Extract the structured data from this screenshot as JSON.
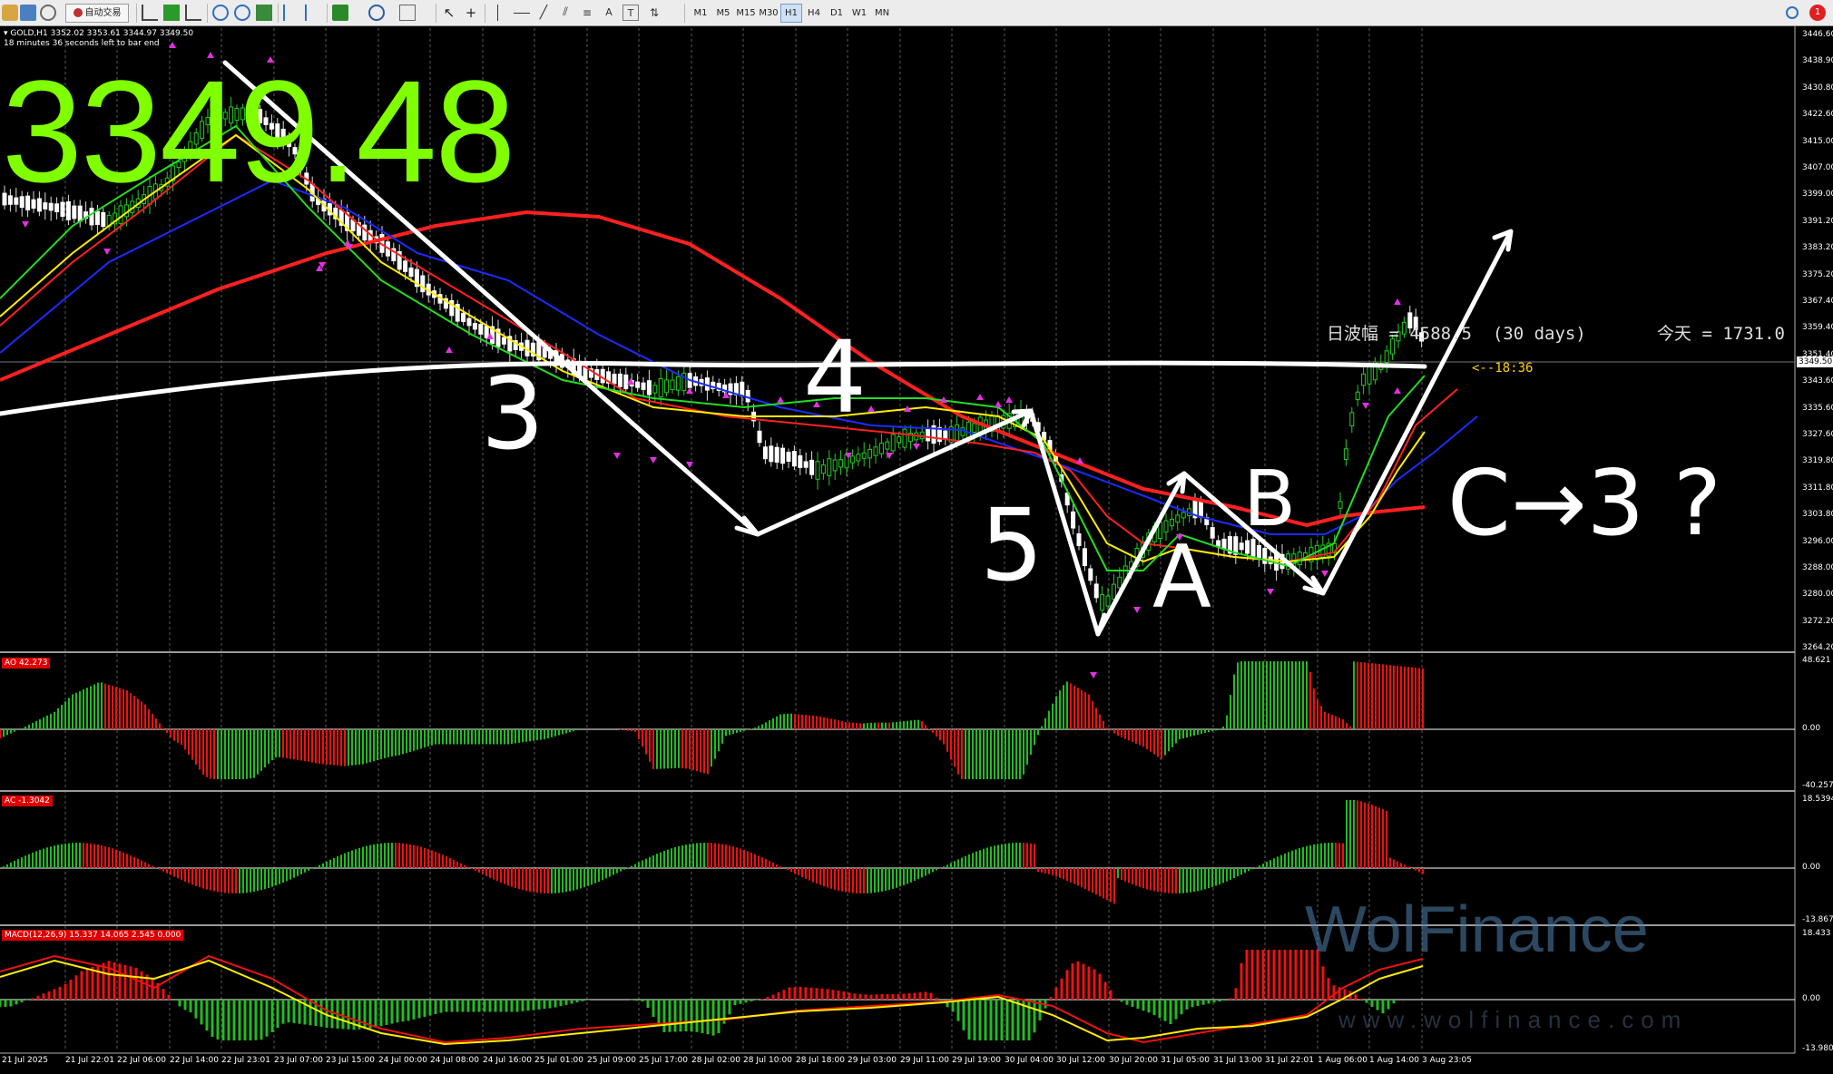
{
  "toolbar": {
    "autotrade_label": "自动交易",
    "timeframes": [
      "M1",
      "M5",
      "M15",
      "M30",
      "H1",
      "H4",
      "D1",
      "W1",
      "MN"
    ],
    "active_timeframe": "H1",
    "notification_count": "1"
  },
  "chart": {
    "symbol_line": "GOLD,H1  3352.02 3353.61 3344.97 3349.50",
    "bar_timer": "18 minutes 36 seconds left to bar end",
    "big_price": "3349.48",
    "daily_range_text": "日波幅 = 4588.5  (30 days)",
    "today_text": "今天 = 1731.0",
    "countdown": "<--18:36",
    "current_price_label": "3349.50",
    "watermark": "WolFinance",
    "watermark_url": "www.wolfinance.com",
    "annotations": {
      "wave3": "3",
      "wave4": "4",
      "wave5": "5",
      "waveA": "A",
      "waveB": "B",
      "waveC_text": "C→3 ?"
    },
    "price_axis": [
      "3446.60",
      "3438.90",
      "3430.80",
      "3422.60",
      "3415.00",
      "3407.00",
      "3399.00",
      "3391.20",
      "3383.20",
      "3375.20",
      "3367.40",
      "3359.40",
      "3351.40",
      "3343.60",
      "3335.60",
      "3327.60",
      "3319.80",
      "3311.80",
      "3303.80",
      "3296.00",
      "3288.00",
      "3280.00",
      "3272.20",
      "3264.20"
    ],
    "time_axis": [
      "21 Jul 2025",
      "21 Jul 22:01",
      "22 Jul 06:00",
      "22 Jul 14:00",
      "22 Jul 23:01",
      "23 Jul 07:00",
      "23 Jul 15:00",
      "24 Jul 00:00",
      "24 Jul 08:00",
      "24 Jul 16:00",
      "25 Jul 01:00",
      "25 Jul 09:00",
      "25 Jul 17:00",
      "28 Jul 02:00",
      "28 Jul 10:00",
      "28 Jul 18:00",
      "29 Jul 03:00",
      "29 Jul 11:00",
      "29 Jul 19:00",
      "30 Jul 04:00",
      "30 Jul 12:00",
      "30 Jul 20:00",
      "31 Jul 05:00",
      "31 Jul 13:00",
      "31 Jul 22:01",
      "1 Aug 06:00",
      "1 Aug 14:00",
      "3 Aug 23:05"
    ]
  },
  "indicators": {
    "ao": {
      "label": "AO 42.273",
      "axis": [
        "48.621",
        "0.00",
        "-40.257"
      ]
    },
    "ac": {
      "label": "AC -1.3042",
      "axis": [
        "18.5394",
        "0.00",
        "-13.8676"
      ]
    },
    "macd": {
      "label": "MACD(12,26,9) 15.337 14.065 2.545 0.000",
      "axis": [
        "18.433",
        "0.00",
        "-13.980"
      ]
    }
  },
  "colors": {
    "bull": "#22bb22",
    "bear": "#ee1111",
    "ma_red": "#ff2020",
    "ma_blue": "#1a2cff",
    "ma_yellow": "#ffee00",
    "ma_green": "#22dd22",
    "big_price": "#7fff00",
    "fractal": "#e030e0"
  }
}
